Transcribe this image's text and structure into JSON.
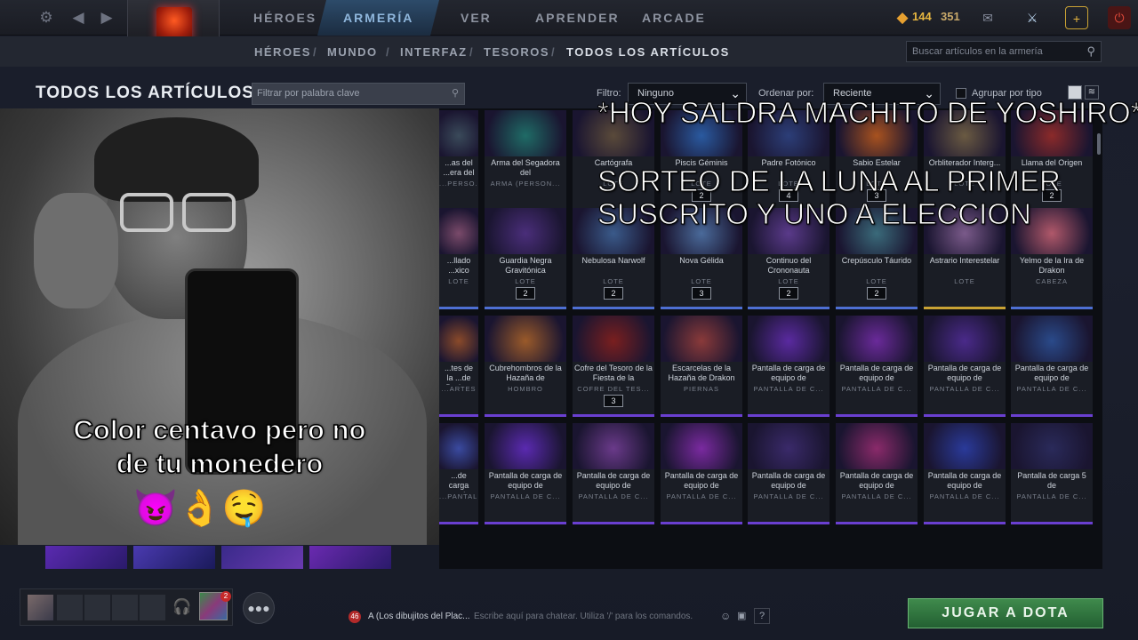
{
  "topbar": {
    "nav": [
      "HÉROES",
      "ARMERÍA",
      "VER",
      "APRENDER",
      "ARCADE"
    ],
    "gold": "144",
    "shards": "351"
  },
  "breadcrumb": [
    "HÉROES",
    "MUNDO",
    "INTERFAZ",
    "TESOROS",
    "TODOS LOS ARTÍCULOS"
  ],
  "search_placeholder": "Buscar artículos en la armería",
  "page_title": "TODOS LOS ARTÍCULOS",
  "filter_placeholder": "Filtrar por palabra clave",
  "filter_label": "Filtro:",
  "filter_value": "Ninguno",
  "sort_label": "Ordenar por:",
  "sort_value": "Reciente",
  "group_label": "Agrupar por tipo",
  "items": [
    {
      "name": "...as del ...era del",
      "cat": "...PERSO...",
      "col": "#3a4a5a"
    },
    {
      "name": "Arma del Segadora del",
      "cat": "ARMA (PERSON...",
      "col": "#1f6b66"
    },
    {
      "name": "Cartógrafa",
      "cat": "LOTE",
      "count": "",
      "col": "#5a4a3a"
    },
    {
      "name": "Piscis Géminis",
      "cat": "LOTE",
      "count": "2",
      "col": "#2a5aa0"
    },
    {
      "name": "Padre Fotónico",
      "cat": "LOTE",
      "count": "4",
      "col": "#2c3e78"
    },
    {
      "name": "Sabio Estelar",
      "cat": "LOTE",
      "count": "3",
      "col": "#a8521f"
    },
    {
      "name": "Orbliterador Interg...",
      "cat": "LOTE",
      "count": "",
      "col": "#6a5a42"
    },
    {
      "name": "Llama del Origen",
      "cat": "LOTE",
      "count": "2",
      "col": "#8b2a2a"
    },
    {
      "name": "...llado ...xico",
      "cat": "LOTE",
      "col": "#7a4a6a"
    },
    {
      "name": "Guardia Negra Gravitónica",
      "cat": "LOTE",
      "count": "2",
      "col": "#4a2e7a"
    },
    {
      "name": "Nebulosa Narwolf",
      "cat": "LOTE",
      "count": "2",
      "col": "#3a5a8a"
    },
    {
      "name": "Nova Gélida",
      "cat": "LOTE",
      "count": "3",
      "col": "#4a6a9a"
    },
    {
      "name": "Continuo del Crononauta",
      "cat": "LOTE",
      "count": "2",
      "col": "#5a3a8a"
    },
    {
      "name": "Crepúsculo Táurido",
      "cat": "LOTE",
      "count": "2",
      "col": "#3a6a7a"
    },
    {
      "name": "Astrario Interestelar",
      "cat": "LOTE",
      "count": "",
      "col": "#7a5a8a"
    },
    {
      "name": "Yelmo de la Ira de Drakon",
      "cat": "CABEZA",
      "count": "",
      "col": "#b0586a"
    },
    {
      "name": "...tes de la ...de Drakon",
      "cat": "...ARTES",
      "col": "#8a4a2a"
    },
    {
      "name": "Cubrehombros de la Hazaña de",
      "cat": "HOMBRO",
      "col": "#9a5a2a"
    },
    {
      "name": "Cofre del Tesoro de la Fiesta de la",
      "cat": "COFRE DEL TES...",
      "count": "3",
      "col": "#7a1f1f"
    },
    {
      "name": "Escarcelas de la Hazaña de Drakon",
      "cat": "PIERNAS",
      "col": "#8a3a3a"
    },
    {
      "name": "Pantalla de carga de equipo de",
      "cat": "PANTALLA DE C...",
      "col": "#5a2aa0"
    },
    {
      "name": "Pantalla de carga de equipo de",
      "cat": "PANTALLA DE C...",
      "col": "#6a2a9a"
    },
    {
      "name": "Pantalla de carga de equipo de",
      "cat": "PANTALLA DE C...",
      "col": "#4a2a8a"
    },
    {
      "name": "Pantalla de carga de equipo de",
      "cat": "PANTALLA DE C...",
      "col": "#2a4a8a"
    },
    {
      "name": "...de carga ...equipo de",
      "cat": "...PANTALLA DE C...",
      "col": "#3a4aa0"
    },
    {
      "name": "Pantalla de carga de equipo de",
      "cat": "PANTALLA DE C...",
      "col": "#5a2ab0"
    },
    {
      "name": "Pantalla de carga de equipo de",
      "cat": "PANTALLA DE C...",
      "col": "#6a3a8a"
    },
    {
      "name": "Pantalla de carga de equipo de",
      "cat": "PANTALLA DE C...",
      "col": "#7a2aa0"
    },
    {
      "name": "Pantalla de carga de equipo de",
      "cat": "PANTALLA DE C...",
      "col": "#3a2a6a"
    },
    {
      "name": "Pantalla de carga de equipo de",
      "cat": "PANTALLA DE C...",
      "col": "#8a2a6a"
    },
    {
      "name": "Pantalla de carga de equipo de",
      "cat": "PANTALLA DE C...",
      "col": "#2a3a9a"
    },
    {
      "name": "Pantalla de carga 5 de",
      "cat": "PANTALLA DE C...",
      "col": "#2a2a5a"
    }
  ],
  "meme_line1": "Color centavo pero no",
  "meme_line2": "de tu monedero",
  "meme_emoji": "😈👌🤤",
  "overlay_line1": "*HOY SALDRA MACHITO DE YOSHIRO*",
  "overlay_line2": "SORTEO DE LA LUNA AL  PRIMER",
  "overlay_line3": "SUSCRITO Y UNO A ELECCION",
  "chat_badge": "46",
  "chat_channel": "A (Los dibujitos del Plac...",
  "chat_placeholder": "Escribe aquí para chatear. Utiliza '/' para los comandos.",
  "friends_badge": "2",
  "play_label": "JUGAR A DOTA"
}
